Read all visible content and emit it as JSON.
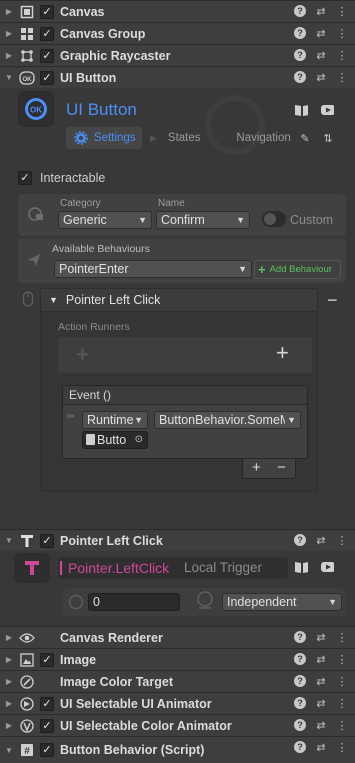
{
  "components_top": [
    {
      "title": "Canvas",
      "icon": "canvas-icon",
      "checked": true
    },
    {
      "title": "Canvas Group",
      "icon": "canvas-group-icon",
      "checked": true
    },
    {
      "title": "Graphic Raycaster",
      "icon": "graphic-raycaster-icon",
      "checked": true
    },
    {
      "title": "UI Button",
      "icon": "ui-button-icon",
      "checked": true
    }
  ],
  "ui_button": {
    "title": "UI Button",
    "tabs": {
      "settings": "Settings",
      "states": "States",
      "navigation": "Navigation"
    },
    "interactable_label": "Interactable",
    "interactable_checked": true,
    "category_label": "Category",
    "category_value": "Generic",
    "name_label": "Name",
    "name_value": "Confirm",
    "custom_label": "Custom",
    "available_behaviours_label": "Available Behaviours",
    "available_behaviour_value": "PointerEnter",
    "add_behaviour_label": "Add Behaviour",
    "behaviour_title": "Pointer Left Click",
    "action_runners_label": "Action Runners",
    "event_title": "Event ()",
    "event_runtime": "Runtime",
    "event_method": "ButtonBehavior.SomeM",
    "event_object": "Butto",
    "plus_label": "+",
    "minus_label": "−"
  },
  "pointer_left_click": {
    "title": "Pointer Left Click",
    "trigger_name": "Pointer.LeftClick",
    "trigger_type": "Local Trigger",
    "value": "0",
    "mode": "Independent"
  },
  "components_bottom": [
    {
      "title": "Canvas Renderer",
      "icon": "eye-icon",
      "checked": null
    },
    {
      "title": "Image",
      "icon": "image-icon",
      "checked": true
    },
    {
      "title": "Image Color Target",
      "icon": "color-target-icon",
      "checked": null
    },
    {
      "title": "UI Selectable UI Animator",
      "icon": "selectable-animator-icon",
      "checked": true
    },
    {
      "title": "UI Selectable Color Animator",
      "icon": "selectable-color-animator-icon",
      "checked": true
    },
    {
      "title": "Button Behavior (Script)",
      "icon": "script-icon",
      "checked": true
    }
  ],
  "colors": {
    "accent_blue": "#4c8df6",
    "accent_pink": "#d0479a",
    "add_green": "#5fbf5f"
  }
}
